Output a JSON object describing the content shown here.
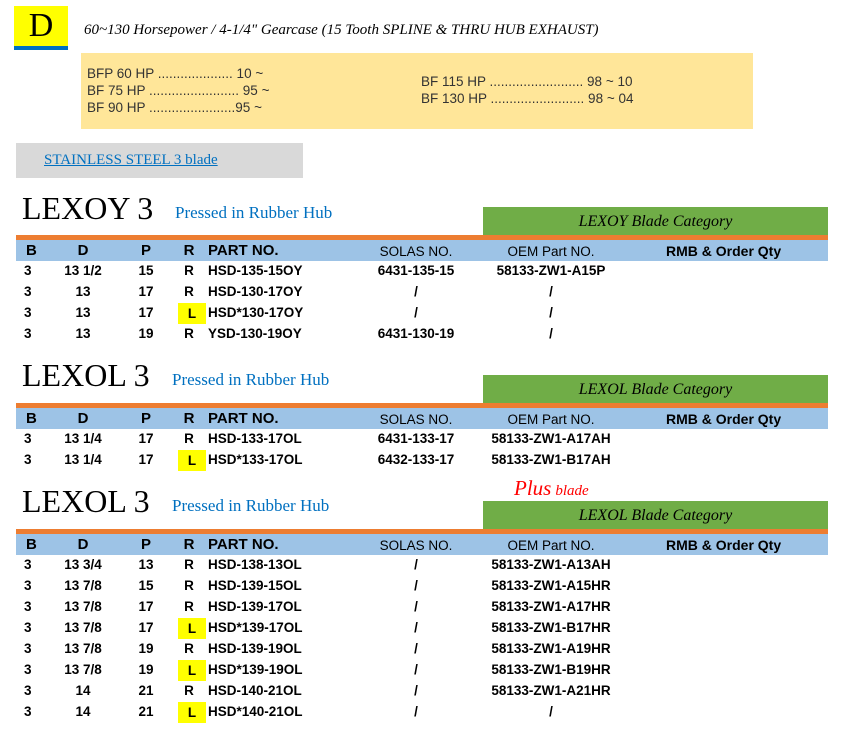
{
  "header": {
    "badge": "D",
    "title": "60~130 Horsepower / 4-1/4\" Gearcase (15 Tooth SPLINE & THRU HUB EXHAUST)"
  },
  "hp_list": {
    "left": [
      "BFP 60 HP .................... 10 ~",
      "BF 75 HP ........................ 95 ~",
      "BF 90 HP .......................95 ~"
    ],
    "right": [
      "BF 115 HP ......................... 98 ~ 10",
      "BF 130 HP ......................... 98 ~ 04"
    ]
  },
  "material_tab": "STAINLESS STEEL  3 blade",
  "columns": {
    "b": "B",
    "d": "D",
    "p": "P",
    "r": "R",
    "part": "PART NO.",
    "solas": "SOLAS NO.",
    "oem": "OEM Part NO.",
    "rmb": "RMB & Order Qty"
  },
  "sections": [
    {
      "title": "LEXOY 3",
      "subtitle": "Pressed in Rubber Hub",
      "category": "LEXOY Blade Category",
      "rows": [
        {
          "b": "3",
          "d": "13 1/2",
          "p": "15",
          "r": "R",
          "part": "HSD-135-15OY",
          "solas": "6431-135-15",
          "oem": "58133-ZW1-A15P"
        },
        {
          "b": "3",
          "d": "13",
          "p": "17",
          "r": "R",
          "part": "HSD-130-17OY",
          "solas": "/",
          "oem": "/"
        },
        {
          "b": "3",
          "d": "13",
          "p": "17",
          "r": "L",
          "part": "HSD*130-17OY",
          "solas": "/",
          "oem": "/"
        },
        {
          "b": "3",
          "d": "13",
          "p": "19",
          "r": "R",
          "part": "YSD-130-19OY",
          "solas": "6431-130-19",
          "oem": "/"
        }
      ]
    },
    {
      "title": "LEXOL 3",
      "subtitle": "Pressed in Rubber Hub",
      "category": "LEXOL Blade Category",
      "rows": [
        {
          "b": "3",
          "d": "13 1/4",
          "p": "17",
          "r": "R",
          "part": "HSD-133-17OL",
          "solas": "6431-133-17",
          "oem": "58133-ZW1-A17AH"
        },
        {
          "b": "3",
          "d": "13 1/4",
          "p": "17",
          "r": "L",
          "part": "HSD*133-17OL",
          "solas": "6432-133-17",
          "oem": "58133-ZW1-B17AH"
        }
      ]
    },
    {
      "title": "LEXOL 3",
      "subtitle": "Pressed in Rubber Hub",
      "plus_big": "Plus",
      "plus_small": "blade",
      "category": "LEXOL Blade Category",
      "rows": [
        {
          "b": "3",
          "d": "13 3/4",
          "p": "13",
          "r": "R",
          "part": "HSD-138-13OL",
          "solas": "/",
          "oem": "58133-ZW1-A13AH"
        },
        {
          "b": "3",
          "d": "13 7/8",
          "p": "15",
          "r": "R",
          "part": "HSD-139-15OL",
          "solas": "/",
          "oem": "58133-ZW1-A15HR"
        },
        {
          "b": "3",
          "d": "13 7/8",
          "p": "17",
          "r": "R",
          "part": "HSD-139-17OL",
          "solas": "/",
          "oem": "58133-ZW1-A17HR"
        },
        {
          "b": "3",
          "d": "13 7/8",
          "p": "17",
          "r": "L",
          "part": "HSD*139-17OL",
          "solas": "/",
          "oem": "58133-ZW1-B17HR"
        },
        {
          "b": "3",
          "d": "13 7/8",
          "p": "19",
          "r": "R",
          "part": "HSD-139-19OL",
          "solas": "/",
          "oem": "58133-ZW1-A19HR"
        },
        {
          "b": "3",
          "d": "13 7/8",
          "p": "19",
          "r": "L",
          "part": "HSD*139-19OL",
          "solas": "/",
          "oem": "58133-ZW1-B19HR"
        },
        {
          "b": "3",
          "d": "14",
          "p": "21",
          "r": "R",
          "part": "HSD-140-21OL",
          "solas": "/",
          "oem": "58133-ZW1-A21HR"
        },
        {
          "b": "3",
          "d": "14",
          "p": "21",
          "r": "L",
          "part": "HSD*140-21OL",
          "solas": "/",
          "oem": "/"
        }
      ]
    }
  ]
}
